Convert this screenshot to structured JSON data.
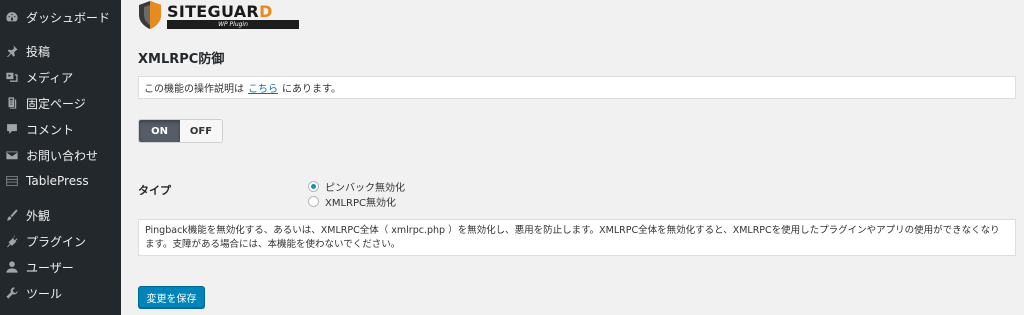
{
  "sidebar": {
    "items": [
      {
        "label": "ダッシュボード",
        "icon": "dashboard-icon"
      },
      {
        "label": "投稿",
        "icon": "pin-icon"
      },
      {
        "label": "メディア",
        "icon": "media-icon"
      },
      {
        "label": "固定ページ",
        "icon": "page-icon"
      },
      {
        "label": "コメント",
        "icon": "comment-icon"
      },
      {
        "label": "お問い合わせ",
        "icon": "mail-icon"
      },
      {
        "label": "TablePress",
        "icon": "table-icon"
      },
      {
        "label": "外観",
        "icon": "brush-icon"
      },
      {
        "label": "プラグイン",
        "icon": "plugin-icon"
      },
      {
        "label": "ユーザー",
        "icon": "user-icon"
      },
      {
        "label": "ツール",
        "icon": "wrench-icon"
      }
    ]
  },
  "logo": {
    "text_main": "SITEGUAR",
    "text_d": "D",
    "subtitle": "WP Plugin"
  },
  "page": {
    "title": "XMLRPC防御",
    "desc_prefix": "この機能の操作説明は",
    "desc_link": "こちら",
    "desc_suffix": "にあります。",
    "toggle": {
      "on": "ON",
      "off": "OFF",
      "selected": "ON"
    },
    "type_label": "タイプ",
    "radio_options": [
      {
        "label": "ピンバック無効化",
        "checked": true
      },
      {
        "label": "XMLRPC無効化",
        "checked": false
      }
    ],
    "info_text": "Pingback機能を無効化する、あるいは、XMLRPC全体（ xmlrpc.php ）を無効化し、悪用を防止します。XMLRPC全体を無効化すると、XMLRPCを使用したプラグインやアプリの使用ができなくなります。支障がある場合には、本機能を使わないでください。",
    "save_label": "変更を保存"
  },
  "colors": {
    "sidebar_bg": "#23282d",
    "accent": "#0085ba",
    "logo_orange": "#e98a1c"
  }
}
